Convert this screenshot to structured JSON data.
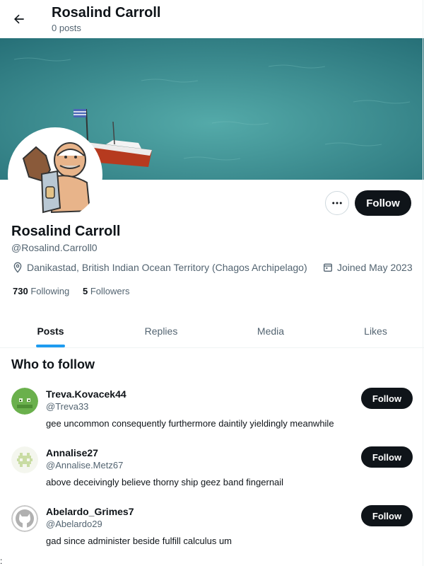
{
  "header": {
    "title": "Rosalind Carroll",
    "post_count": "0 posts"
  },
  "profile": {
    "name": "Rosalind Carroll",
    "handle": "@Rosalind.Carroll0",
    "location": "Danikastad, British Indian Ocean Territory (Chagos Archipelago)",
    "joined": "Joined May 2023",
    "following_count": "730",
    "following_label": "Following",
    "followers_count": "5",
    "followers_label": "Followers",
    "follow_label": "Follow"
  },
  "tabs": [
    {
      "label": "Posts",
      "active": true
    },
    {
      "label": "Replies",
      "active": false
    },
    {
      "label": "Media",
      "active": false
    },
    {
      "label": "Likes",
      "active": false
    }
  ],
  "who_to_follow": {
    "title": "Who to follow",
    "suggestions": [
      {
        "name": "Treva.Kovacek44",
        "handle": "@Treva33",
        "bio": "gee uncommon consequently furthermore daintily yieldingly meanwhile",
        "button": "Follow",
        "avatar": "green-frog-avatar"
      },
      {
        "name": "Annalise27",
        "handle": "@Annalise.Metz67",
        "bio": "above deceivingly believe thorny ship geez band fingernail",
        "button": "Follow",
        "avatar": "pixel-invader-avatar"
      },
      {
        "name": "Abelardo_Grimes7",
        "handle": "@Abelardo29",
        "bio": "gad since administer beside fulfill calculus um",
        "button": "Follow",
        "avatar": "github-cat-avatar"
      }
    ]
  },
  "footer_glyph": ":",
  "colors": {
    "accent": "#1d9bf0",
    "button_dark": "#0f1419",
    "secondary_text": "#536471",
    "banner_water": "#3a9297"
  },
  "icons": {
    "back": "arrow-left-icon",
    "more": "ellipsis-icon",
    "location": "map-pin-icon",
    "joined": "calendar-icon"
  }
}
